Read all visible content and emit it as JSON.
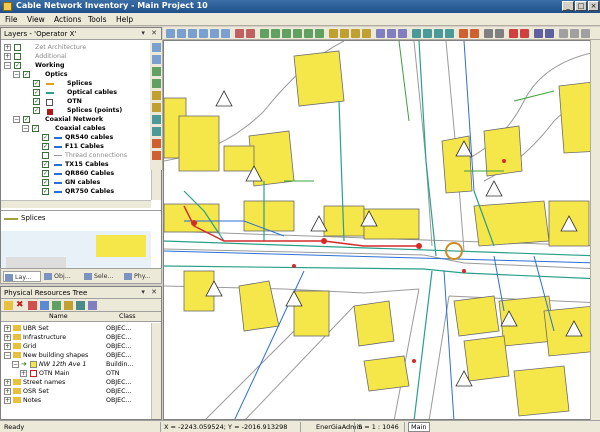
{
  "window": {
    "title": "Cable Network Inventory - Main Project 10",
    "buttons": [
      "_",
      "□",
      "×"
    ]
  },
  "menu": [
    "File",
    "View",
    "Actions",
    "Tools",
    "Help"
  ],
  "layers_panel": {
    "title": "Layers - 'Operator X'",
    "items": [
      {
        "label": "Zet Architecture",
        "style": "gray"
      },
      {
        "label": "Additional",
        "style": "gray"
      },
      {
        "label": "Working",
        "style": "bold"
      },
      {
        "label": "Optics",
        "style": "bold"
      },
      {
        "label": "Splices",
        "style": "bold"
      },
      {
        "label": "Optical cables",
        "style": "bold"
      },
      {
        "label": "OTN",
        "style": "bold"
      },
      {
        "label": "Splices (points)",
        "style": "bold"
      },
      {
        "label": "Coaxial Network",
        "style": "bold"
      },
      {
        "label": "Coaxial cables",
        "style": "bold"
      },
      {
        "label": "QR540 cables",
        "style": "bold"
      },
      {
        "label": "F11 Cables",
        "style": "bold"
      },
      {
        "label": "Thread connections",
        "style": "gray"
      },
      {
        "label": "TX15 Cables",
        "style": "bold"
      },
      {
        "label": "QR860 Cables",
        "style": "bold"
      },
      {
        "label": "GN cables",
        "style": "bold"
      },
      {
        "label": "QR750 Cables",
        "style": "bold"
      }
    ],
    "legend_label": "Splices"
  },
  "left_tabs": [
    "Lay...",
    "Obj...",
    "Sele...",
    "Phy..."
  ],
  "resources_panel": {
    "title": "Physical Resources Tree",
    "columns": [
      "Name",
      "Class"
    ],
    "rows": [
      {
        "name": "UBR Set",
        "class": "OBJEC..."
      },
      {
        "name": "Infrastructure",
        "class": "OBJEC..."
      },
      {
        "name": "Grid",
        "class": "OBJEC..."
      },
      {
        "name": "New building shapes",
        "class": "OBJEC..."
      },
      {
        "name": "NW 12th Ave 1",
        "class": "Buildin..."
      },
      {
        "name": "OTN Main",
        "class": "OTN"
      },
      {
        "name": "Street names",
        "class": "OBJEC..."
      },
      {
        "name": "OSR Set",
        "class": "OBJEC..."
      },
      {
        "name": "Notes",
        "class": "OBJEC..."
      }
    ]
  },
  "statusbar": {
    "status": "Ready",
    "coords": "X = -2243.059524; Y = -2016.913298",
    "user": "EnerGiaAdmin",
    "scale": "S = 1 : 1046",
    "mode": "Main"
  },
  "colors": {
    "building_fill": "#f5e64a",
    "street": "#9a9a9a",
    "optical_cable": "#2aa08a",
    "coax_cable": "#2b6fd6",
    "splice_red": "#d42a2a",
    "green_line": "#3ca03c"
  }
}
